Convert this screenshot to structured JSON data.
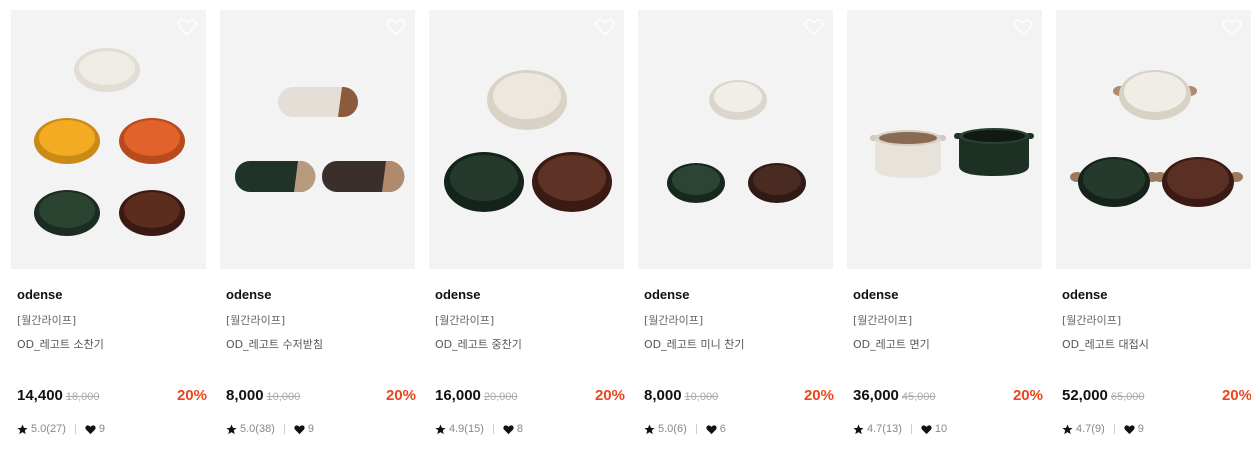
{
  "products": [
    {
      "brand": "odense",
      "tag": "[월간라이프]",
      "name": "OD_레고트 소찬기",
      "price": "14,400",
      "original_price": "18,000",
      "discount": "20%",
      "rating": "5.0(27)",
      "likes": "9"
    },
    {
      "brand": "odense",
      "tag": "[월간라이프]",
      "name": "OD_레고트 수저받침",
      "price": "8,000",
      "original_price": "10,000",
      "discount": "20%",
      "rating": "5.0(38)",
      "likes": "9"
    },
    {
      "brand": "odense",
      "tag": "[월간라이프]",
      "name": "OD_레고트 중찬기",
      "price": "16,000",
      "original_price": "20,000",
      "discount": "20%",
      "rating": "4.9(15)",
      "likes": "8"
    },
    {
      "brand": "odense",
      "tag": "[월간라이프]",
      "name": "OD_레고트 미니 찬기",
      "price": "8,000",
      "original_price": "10,000",
      "discount": "20%",
      "rating": "5.0(6)",
      "likes": "6"
    },
    {
      "brand": "odense",
      "tag": "[월간라이프]",
      "name": "OD_레고트 면기",
      "price": "36,000",
      "original_price": "45,000",
      "discount": "20%",
      "rating": "4.7(13)",
      "likes": "10"
    },
    {
      "brand": "odense",
      "tag": "[월간라이프]",
      "name": "OD_레고트 대접시",
      "price": "52,000",
      "original_price": "65,000",
      "discount": "20%",
      "rating": "4.7(9)",
      "likes": "9"
    }
  ],
  "colors": {
    "discount": "#e8461e",
    "thumb_bg": "#f3f3f3"
  },
  "icons": {
    "wishlist": "heart-outline-icon",
    "rating": "star-icon",
    "likes": "heart-filled-icon"
  }
}
